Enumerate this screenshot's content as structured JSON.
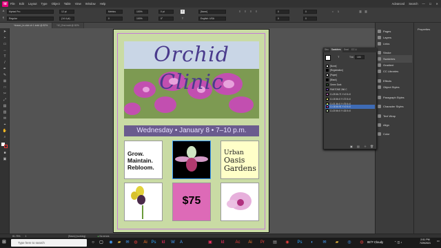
{
  "menubar": {
    "app_icon": "Id",
    "items": [
      "File",
      "Edit",
      "Layout",
      "Type",
      "Object",
      "Table",
      "View",
      "Window",
      "Help"
    ],
    "workspace": "Advanced",
    "search_placeholder": "Search"
  },
  "control": {
    "font": "Myriad Pro",
    "style": "Regular",
    "size": "12 pt",
    "leading": "(14.4 pt)",
    "kerning": "Metrics",
    "tracking": "0",
    "scale_v": "100%",
    "scale_h": "100%",
    "baseline": "0 pt",
    "skew": "0°",
    "char_style": "[None]",
    "language": "English: USA",
    "spacing": "0"
  },
  "document_tabs": [
    {
      "label": "*drawn_in-club ch 1.indd @ 82%",
      "active": true
    },
    {
      "label": "*10_End.indd @ 82%",
      "active": false
    }
  ],
  "page": {
    "title": "Orchid Clinic",
    "date_line": "Wednesday • January 8 • 7–10 p.m.",
    "grow_lines": [
      "Grow.",
      "Maintain.",
      "Rebloom."
    ],
    "urban_lines": [
      "Urban",
      "Oasis",
      "Gardens"
    ],
    "price": "$75"
  },
  "swatches_panel": {
    "tabs": [
      "Stro",
      "Swatches",
      "Grad",
      "CC Li"
    ],
    "tint_label": "Tint:",
    "tint_value": "100",
    "items": [
      {
        "name": "[None]",
        "color": "#ffffff"
      },
      {
        "name": "[Registration]",
        "color": "#000000"
      },
      {
        "name": "[Paper]",
        "color": "#ffffff"
      },
      {
        "name": "[Black]",
        "color": "#000000"
      },
      {
        "name": "Green Dark",
        "color": "#2d5a2d"
      },
      {
        "name": "PANTONE 266 C",
        "color": "#6a3db8"
      },
      {
        "name": "C=25 M=71 Y=0 K=0",
        "color": "#b866b5"
      },
      {
        "name": "C=15 M=0 Y=72 K=0",
        "color": "#e4ed6e"
      },
      {
        "name": "C=21 M=0 Y=75 K=0",
        "color": "#d2e56a"
      },
      {
        "name": "C=18 M=91 Y=0 K=0",
        "color": "#c93f9a"
      },
      {
        "name": "C=20 M=0 Y=33 K=0",
        "color": "#cfe4b8"
      }
    ],
    "selected_index": 9
  },
  "side_panels": [
    "Pages",
    "Layers",
    "Links",
    "Stroke",
    "Swatches",
    "Gradient",
    "CC Libraries",
    "Effects",
    "Object Styles",
    "Paragraph Styles",
    "Character Styles",
    "Text Wrap",
    "Align",
    "Color"
  ],
  "properties_label": "Properties",
  "status": {
    "zoom": "81.75%",
    "page": "1",
    "style": "[Basic] (working)",
    "errors": "No errors"
  },
  "taskbar": {
    "search_placeholder": "Type here to search",
    "weather": "95°F Cloudy",
    "time": "2:51 PM",
    "date": "7/29/2021"
  }
}
